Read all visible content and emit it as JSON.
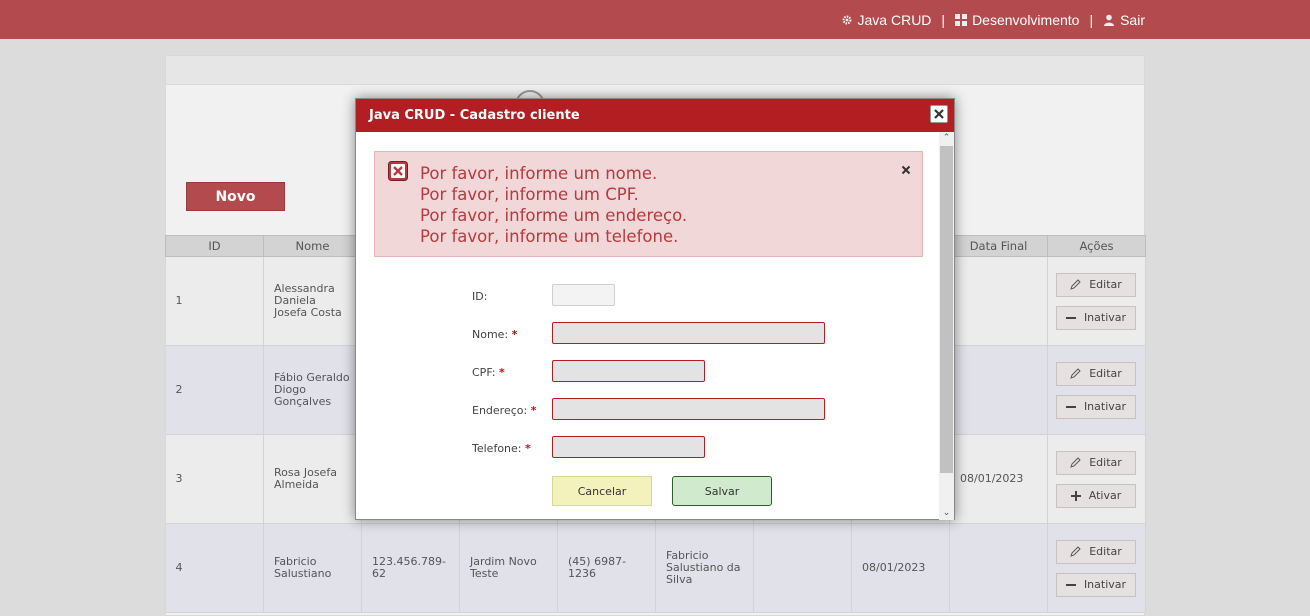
{
  "topnav": {
    "app_label": "Java CRUD",
    "dev_label": "Desenvolvimento",
    "logout_label": "Sair",
    "separator": "|"
  },
  "page": {
    "new_button": "Novo"
  },
  "table": {
    "headers": [
      "ID",
      "Nome",
      "",
      "",
      "",
      "",
      "",
      "",
      "Data Final",
      "Ações"
    ],
    "rows": [
      {
        "id": "1",
        "nome": "Alessandra Daniela Josefa Costa",
        "cpf": "",
        "endereco": "",
        "telefone": "",
        "responsavel": "",
        "c7": "",
        "c8": "",
        "data_final": "",
        "action1": "Editar",
        "action2": "Inativar"
      },
      {
        "id": "2",
        "nome": "Fábio Geraldo Diogo Gonçalves",
        "cpf": "",
        "endereco": "",
        "telefone": "",
        "responsavel": "",
        "c7": "",
        "c8": "",
        "data_final": "",
        "action1": "Editar",
        "action2": "Inativar"
      },
      {
        "id": "3",
        "nome": "Rosa Josefa Almeida",
        "cpf": "",
        "endereco": "",
        "telefone": "",
        "responsavel": "",
        "c7": "",
        "c8": "",
        "data_final": "08/01/2023",
        "action1": "Editar",
        "action2": "Ativar"
      },
      {
        "id": "4",
        "nome": "Fabricio Salustiano",
        "cpf": "123.456.789-62",
        "endereco": "Jardim Novo Teste",
        "telefone": "(45) 6987-1236",
        "responsavel": "Fabricio Salustiano da Silva",
        "c7": "",
        "c8": "08/01/2023",
        "data_final": "",
        "action1": "Editar",
        "action2": "Inativar"
      }
    ]
  },
  "dialog": {
    "title": "Java CRUD - Cadastro cliente",
    "errors": [
      "Por favor, informe um nome.",
      "Por favor, informe um CPF.",
      "Por favor, informe um endereço.",
      "Por favor, informe um telefone."
    ],
    "form": {
      "id_label": "ID:",
      "nome_label": "Nome:",
      "cpf_label": "CPF:",
      "endereco_label": "Endereço:",
      "telefone_label": "Telefone:",
      "required_mark": "*",
      "id_value": "",
      "nome_value": "",
      "cpf_value": "",
      "endereco_value": "",
      "telefone_value": ""
    },
    "cancel_label": "Cancelar",
    "save_label": "Salvar"
  },
  "colors": {
    "topbar": "#b34a4e",
    "dialog_header": "#b21e22",
    "error_text": "#b8393e",
    "error_bg": "#f1d7d8",
    "save_bg": "#cfeacc",
    "cancel_bg": "#f3f2bd"
  },
  "icons": {
    "app": "gear-icon",
    "dev": "grid-icon",
    "logout": "user-icon",
    "edit": "pencil-icon",
    "inactivate": "minus-icon",
    "activate": "plus-icon",
    "error": "error-x-icon",
    "close": "close-icon"
  }
}
